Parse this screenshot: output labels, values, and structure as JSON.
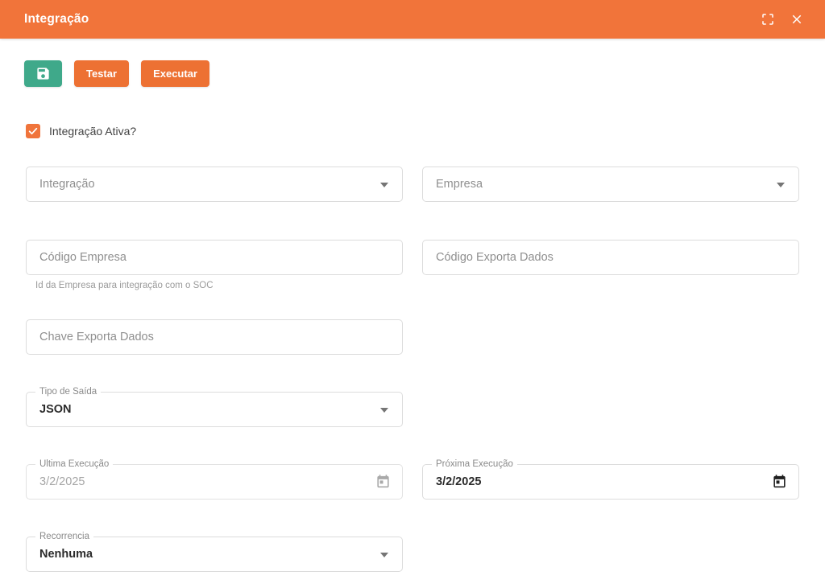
{
  "colors": {
    "primary_orange": "#f1743a",
    "button_orange": "#ed7133",
    "save_green": "#3fa98a",
    "field_border": "#dcdcdc"
  },
  "header": {
    "title": "Integração",
    "icons": {
      "fullscreen": "crop-free-icon",
      "close": "close-icon"
    }
  },
  "toolbar": {
    "save_icon": "save-icon",
    "testar_label": "Testar",
    "executar_label": "Executar"
  },
  "checkbox": {
    "label": "Integração Ativa?",
    "checked": true
  },
  "fields": {
    "integracao": {
      "placeholder": "Integração"
    },
    "empresa": {
      "placeholder": "Empresa"
    },
    "codigo_empresa": {
      "placeholder": "Código Empresa",
      "helper": "Id da Empresa para integração com o SOC"
    },
    "codigo_exporta_dados": {
      "placeholder": "Código Exporta Dados"
    },
    "chave_exporta_dados": {
      "placeholder": "Chave Exporta Dados"
    },
    "tipo_de_saida": {
      "label": "Tipo de Saída",
      "value": "JSON"
    },
    "ultima_execucao": {
      "label": "Ultima Execução",
      "value": "3/2/2025",
      "disabled": true
    },
    "proxima_execucao": {
      "label": "Próxima Execução",
      "value": "3/2/2025",
      "disabled": false
    },
    "recorrencia": {
      "label": "Recorrencia",
      "value": "Nenhuma"
    }
  }
}
